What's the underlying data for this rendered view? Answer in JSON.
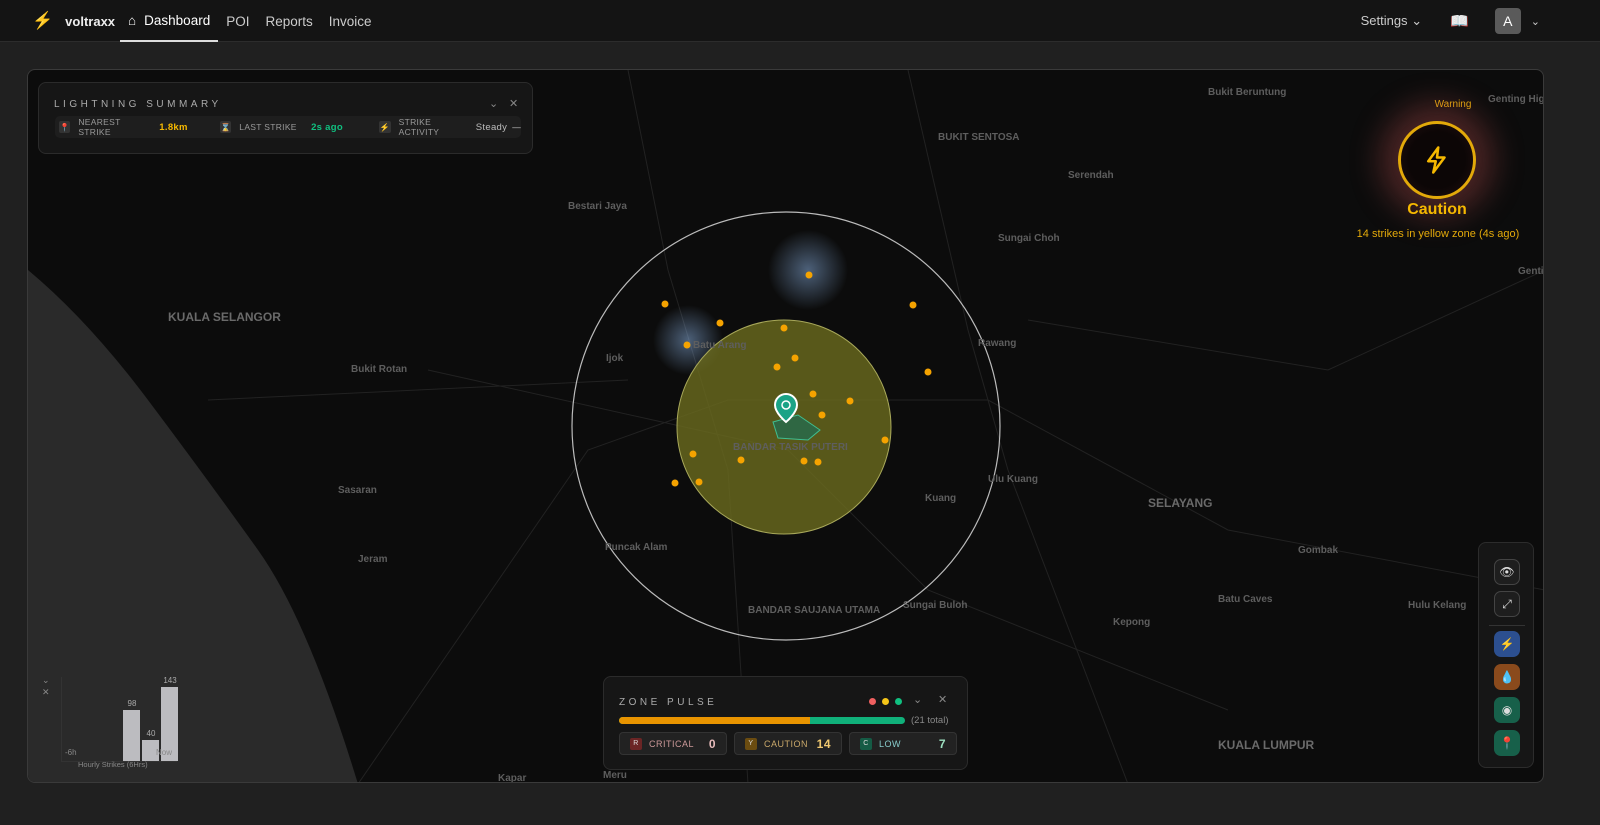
{
  "nav": {
    "brand": "voltraxx",
    "items": [
      "Dashboard",
      "POI",
      "Reports",
      "Invoice"
    ],
    "active": "Dashboard",
    "settings": "Settings",
    "avatar": "A"
  },
  "map_labels": [
    "Bukit Beruntung",
    "Bestari Jaya",
    "KUALA SELANGOR",
    "Serendah",
    "Sungai Choh",
    "Rawang",
    "Ijok",
    "Batu Arang",
    "Bukit Rotan",
    "Kuang",
    "SELAYANG",
    "Puncak Alam",
    "Sungai Buloh",
    "Kepong",
    "Batu Caves",
    "Gombak",
    "Hulu Kelang",
    "KUALA LUMPUR",
    "Sasaran",
    "Jeram",
    "Kapar",
    "Meru",
    "Genting Highlands",
    "Genting Sempah",
    "Ulu Kuang",
    "BUKIT SENTOSA",
    "BANDAR TASIK PUTERI",
    "BANDAR SAUJANA UTAMA"
  ],
  "lightning_summary": {
    "title": "LIGHTNING SUMMARY",
    "nearest_label": "NEAREST STRIKE",
    "nearest_value": "1.8km",
    "last_label": "LAST STRIKE",
    "last_value": "2s ago",
    "activity_label": "STRIKE ACTIVITY",
    "activity_value": "Steady",
    "activity_trend": "—"
  },
  "alert": {
    "level_caption": "Warning",
    "status": "Caution",
    "message": "14 strikes in yellow zone (4s ago)",
    "color": "#f5b800"
  },
  "zone_pulse": {
    "title": "ZONE PULSE",
    "total": "(21 total)",
    "critical_label": "CRITICAL",
    "critical_badge": "R",
    "critical_count": "0",
    "caution_label": "CAUTION",
    "caution_badge": "Y",
    "caution_count": "14",
    "low_label": "LOW",
    "low_badge": "C",
    "low_count": "7",
    "caution_fraction": 0.667,
    "colors": {
      "critical": "#e05555",
      "caution": "#e89400",
      "low": "#10b07a"
    }
  },
  "chart_data": {
    "type": "bar",
    "categories": [
      "-6h",
      "",
      "",
      "",
      "",
      "Now"
    ],
    "values": [
      0,
      0,
      0,
      98,
      40,
      143
    ],
    "data_labels": [
      "98",
      "40",
      "143"
    ],
    "x_start_label": "-6h",
    "x_end_label": "Now",
    "title": "Hourly Strikes (6Hrs)"
  },
  "tools": [
    "eye-icon",
    "fullscreen-icon",
    "lightning-layer-icon",
    "rain-layer-icon",
    "poi-layer-icon",
    "location-icon"
  ]
}
